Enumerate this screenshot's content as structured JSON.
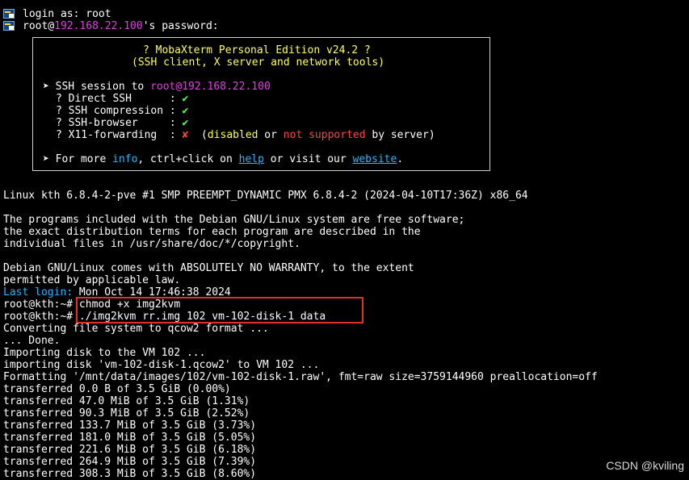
{
  "header": {
    "login_line": "login as: root",
    "pw_user": "root@",
    "pw_host": "192.168.22.100",
    "pw_suffix": "'s password:"
  },
  "banner": {
    "title": "? MobaXterm Personal Edition v24.2 ?",
    "subtitle": "(SSH client, X server and network tools)",
    "session_prefix": "➤ SSH session to ",
    "session_target": "root@192.168.22.100",
    "features": [
      {
        "label": "? Direct SSH      :",
        "mark": "✔"
      },
      {
        "label": "? SSH compression :",
        "mark": "✔"
      },
      {
        "label": "? SSH-browser     :",
        "mark": "✔"
      },
      {
        "label": "? X11-forwarding  :",
        "mark": "✘"
      }
    ],
    "x11_open": "(",
    "x11_disabled": "disabled",
    "x11_or": " or ",
    "x11_not_supported": "not supported",
    "x11_by_server": " by server)",
    "info_prefix": "➤ For more ",
    "info_word": "info",
    "info_mid": ", ctrl+click on ",
    "help_link": "help",
    "info_mid2": " or visit our ",
    "website_link": "website",
    "info_end": "."
  },
  "output": {
    "uname": "Linux kth 6.8.4-2-pve #1 SMP PREEMPT_DYNAMIC PMX 6.8.4-2 (2024-04-10T17:36Z) x86_64",
    "motd1": "The programs included with the Debian GNU/Linux system are free software;",
    "motd2": "the exact distribution terms for each program are described in the",
    "motd3": "individual files in /usr/share/doc/*/copyright.",
    "motd4": "Debian GNU/Linux comes with ABSOLUTELY NO WARRANTY, to the extent",
    "motd5": "permitted by applicable law.",
    "last_login_label": "Last login:",
    "last_login_value": " Mon Oct 14 17:46:38 2024",
    "prompt": "root@kth:~# ",
    "cmd1": "chmod +x img2kvm",
    "cmd2": "./img2kvm rr.img 102 vm-102-disk-1 data",
    "log": [
      "Converting file system to qcow2 format ...",
      "... Done.",
      "Importing disk to the VM 102 ...",
      "importing disk 'vm-102-disk-1.qcow2' to VM 102 ...",
      "Formatting '/mnt/data/images/102/vm-102-disk-1.raw', fmt=raw size=3759144960 preallocation=off",
      "transferred 0.0 B of 3.5 GiB (0.00%)",
      "transferred 47.0 MiB of 3.5 GiB (1.31%)",
      "transferred 90.3 MiB of 3.5 GiB (2.52%)",
      "transferred 133.7 MiB of 3.5 GiB (3.73%)",
      "transferred 181.0 MiB of 3.5 GiB (5.05%)",
      "transferred 221.6 MiB of 3.5 GiB (6.18%)",
      "transferred 264.9 MiB of 3.5 GiB (7.39%)",
      "transferred 308.3 MiB of 3.5 GiB (8.60%)"
    ]
  },
  "watermark": "CSDN @kviling"
}
